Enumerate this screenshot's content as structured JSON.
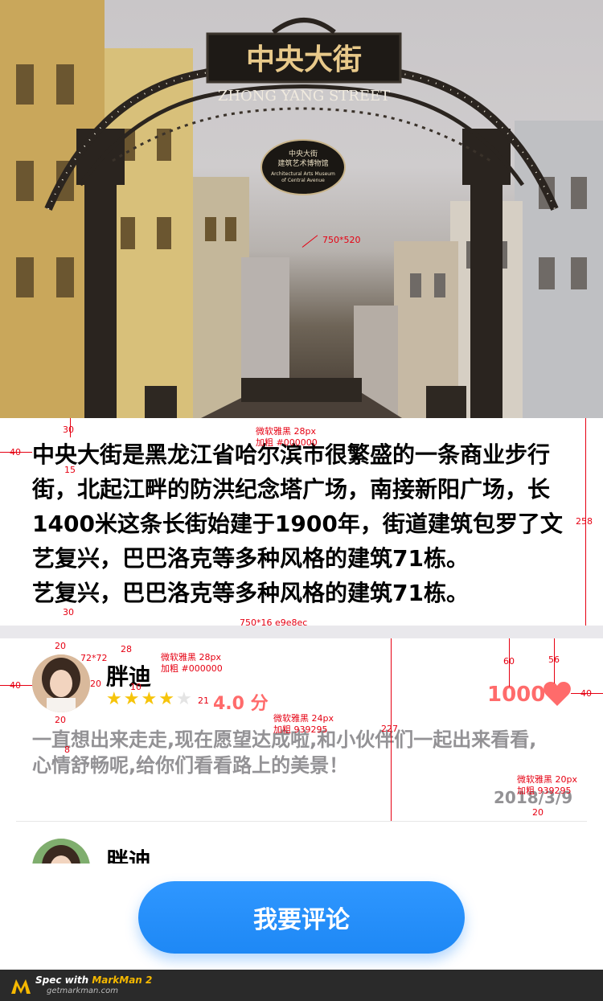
{
  "hero": {
    "sign_title": "中央大街",
    "sign_sub": "ZHONG YANG STREET",
    "plaque_line1": "中央大街",
    "plaque_line2": "建筑艺术博物馆",
    "plaque_line3": "Architectural Arts Museum",
    "plaque_line4": "of Central Avenue"
  },
  "description": {
    "lines": [
      "中央大街是黑龙江省哈尔滨市很繁盛的一条商业步行",
      "街，北起江畔的防洪纪念塔广场，南接新阳广场，长",
      "1400米这条长街始建于1900年，街道建筑包罗了文",
      "艺复兴，巴巴洛克等多种风格的建筑71栋。",
      "艺复兴，巴巴洛克等多种风格的建筑71栋。"
    ]
  },
  "comments": [
    {
      "username": "胖迪",
      "rating": 4,
      "score_text": "4.0 分",
      "likes": "1000",
      "text_lines": [
        "一直想出来走走,现在愿望达成啦,和小伙伴们一起出来看看,",
        "心情舒畅呢,给你们看看路上的美景！"
      ],
      "date": "2018/3/9"
    },
    {
      "username": "胖迪"
    }
  ],
  "action": {
    "comment_button": "我要评论"
  },
  "annotations": {
    "hero_size": "750*520",
    "gap30a": "30",
    "left40a": "40",
    "gap15": "15",
    "desc_font1": "微软雅黑 28px",
    "desc_font2": "加粗 #000000",
    "height258": "258",
    "gap30b": "30",
    "band": "750*16 e9e8ec",
    "gap20a": "20",
    "avatar_size": "72*72",
    "gap28": "28",
    "name_font1": "微软雅黑 28px",
    "name_font2": "加粗 #000000",
    "gap20b": "20",
    "gap10": "10",
    "gap21": "21",
    "left40b": "40",
    "gap20c": "20",
    "gap8": "8",
    "text_font1": "微软雅黑 24px",
    "text_font2": "加粗 939295",
    "height227": "227",
    "gap60": "60",
    "gap56": "56",
    "right40": "40",
    "date_font1": "微软雅黑 20px",
    "date_font2": "加粗 939295",
    "gap20d": "20"
  },
  "footer": {
    "spec_with": "Spec with ",
    "brand": "MarkMan 2",
    "url": "getmarkman.com"
  },
  "colors": {
    "accent": "#1e88f5",
    "like": "#ff6b6b",
    "star": "#f6c40a",
    "gray_text": "#939295",
    "band": "#e9e8ec"
  }
}
